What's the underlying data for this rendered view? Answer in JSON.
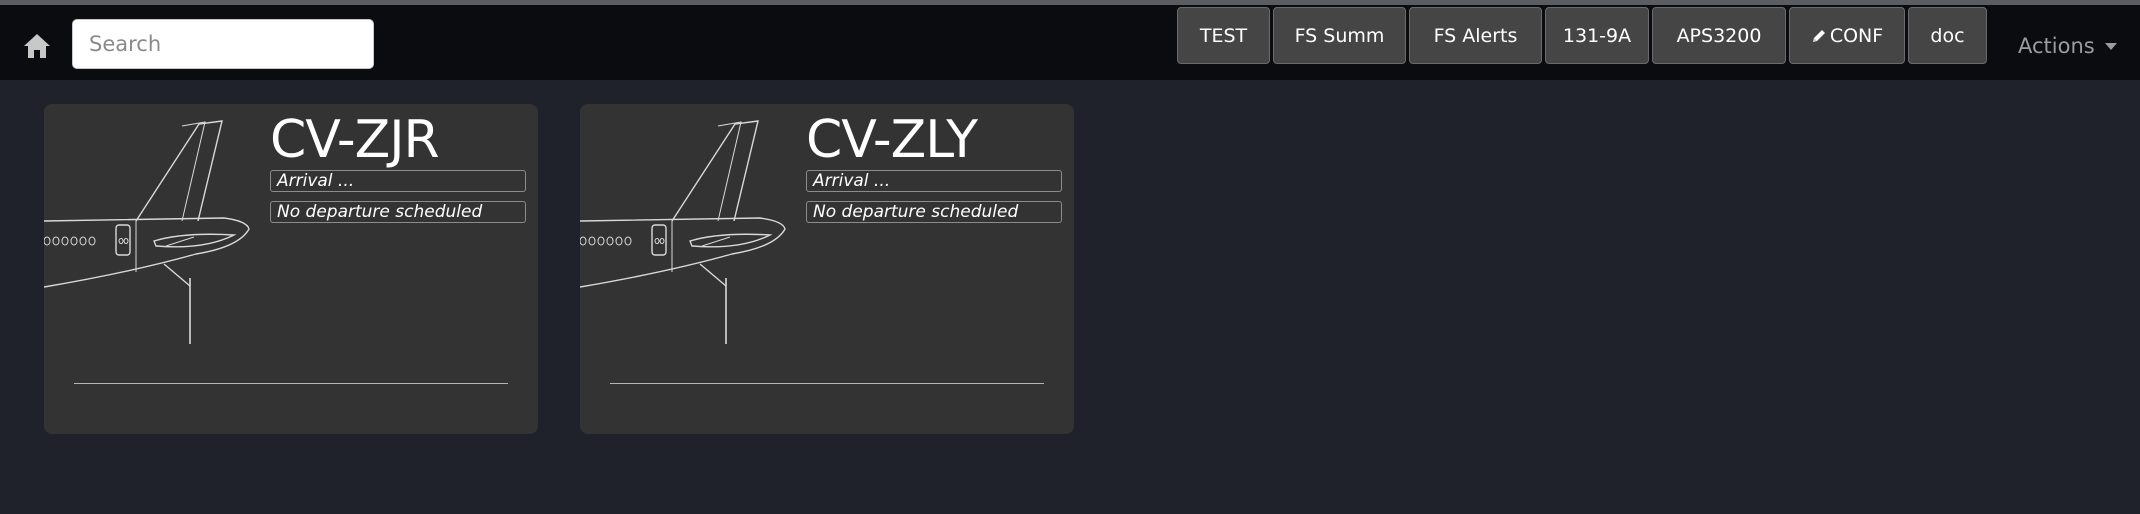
{
  "navbar": {
    "home_icon": "home-icon",
    "search": {
      "placeholder": "Search",
      "value": ""
    },
    "buttons": [
      {
        "label": "TEST"
      },
      {
        "label": "FS Summ"
      },
      {
        "label": "FS Alerts"
      },
      {
        "label": "131-9A"
      },
      {
        "label": "APS3200"
      },
      {
        "label": "CONF",
        "icon": "pencil-icon"
      },
      {
        "label": "doc"
      }
    ],
    "actions_label": "Actions"
  },
  "aircraft": [
    {
      "registration": "CV-ZJR",
      "arrival": "Arrival ...",
      "departure": "No departure scheduled"
    },
    {
      "registration": "CV-ZLY",
      "arrival": "Arrival ...",
      "departure": "No departure scheduled"
    }
  ],
  "colors": {
    "background": "#1f222b",
    "navbar": "#0b0c10",
    "card": "#333333",
    "button": "#454545"
  }
}
